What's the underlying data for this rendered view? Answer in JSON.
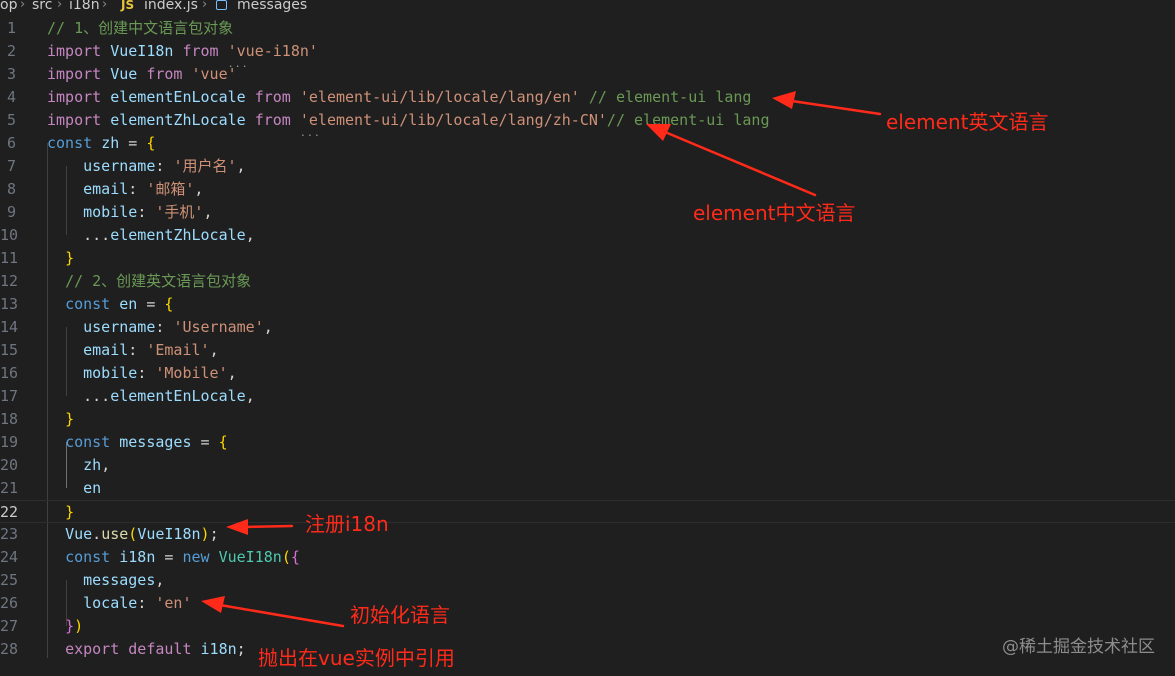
{
  "breadcrumb": {
    "root": "op",
    "folder1": "src",
    "folder2": "i18n",
    "file_badge": "JS",
    "file": "index.js",
    "symbol": "messages"
  },
  "gutter": {
    "numbers": [
      "1",
      "2",
      "3",
      "4",
      "5",
      "6",
      "7",
      "8",
      "9",
      "10",
      "11",
      "12",
      "13",
      "14",
      "15",
      "16",
      "17",
      "18",
      "19",
      "20",
      "21",
      "22",
      "23",
      "24",
      "25",
      "26",
      "27",
      "28"
    ],
    "active_line": "22"
  },
  "code": {
    "l1_comment": "// 1、创建中文语言包对象",
    "l2_import": "import",
    "l2_name": "VueI18n",
    "l2_from": "from",
    "l2_src": "'vue-i18n'",
    "l3_import": "import",
    "l3_name": "Vue",
    "l3_from": "from",
    "l3_src": "'vue'",
    "l4_import": "import",
    "l4_name": "elementEnLocale",
    "l4_from": "from",
    "l4_src": "'element-ui/lib/locale/lang/en'",
    "l4_comment": "// element-ui lang",
    "l5_import": "import",
    "l5_name": "elementZhLocale",
    "l5_from": "from",
    "l5_src": "'element-ui/lib/locale/lang/zh-CN'",
    "l5_comment": "// element-ui lang",
    "l6_const": "const",
    "l6_name": "zh",
    "l6_eq": " = ",
    "l6_brace": "{",
    "l7_key": "username",
    "l7_colon": ": ",
    "l7_val": "'用户名'",
    "l7_comma": ",",
    "l8_key": "email",
    "l8_colon": ": ",
    "l8_val": "'邮箱'",
    "l8_comma": ",",
    "l9_key": "mobile",
    "l9_colon": ": ",
    "l9_val": "'手机'",
    "l9_comma": ",",
    "l10_spread": "...",
    "l10_name": "elementZhLocale",
    "l10_comma": ",",
    "l11_brace": "}",
    "l12_comment": "// 2、创建英文语言包对象",
    "l13_const": "const",
    "l13_name": "en",
    "l13_eq": " = ",
    "l13_brace": "{",
    "l14_key": "username",
    "l14_colon": ": ",
    "l14_val": "'Username'",
    "l14_comma": ",",
    "l15_key": "email",
    "l15_colon": ": ",
    "l15_val": "'Email'",
    "l15_comma": ",",
    "l16_key": "mobile",
    "l16_colon": ": ",
    "l16_val": "'Mobile'",
    "l16_comma": ",",
    "l17_spread": "...",
    "l17_name": "elementEnLocale",
    "l17_comma": ",",
    "l18_brace": "}",
    "l19_const": "const",
    "l19_name": "messages",
    "l19_eq": " = ",
    "l19_brace": "{",
    "l20_name": "zh",
    "l20_comma": ",",
    "l21_name": "en",
    "l22_brace": "}",
    "l23_obj": "Vue",
    "l23_dot": ".",
    "l23_fn": "use",
    "l23_paren_open": "(",
    "l23_arg": "VueI18n",
    "l23_paren_close": ")",
    "l23_semi": ";",
    "l24_const": "const",
    "l24_name": "i18n",
    "l24_eq": " = ",
    "l24_new": "new",
    "l24_cls": "VueI18n",
    "l24_paren": "(",
    "l24_brace": "{",
    "l25_key": "messages",
    "l25_comma": ",",
    "l26_key": "locale",
    "l26_colon": ": ",
    "l26_val": "'en'",
    "l27_brace": "}",
    "l27_paren": ")",
    "l28_export": "export",
    "l28_default": "default",
    "l28_name": "i18n",
    "l28_semi": ";"
  },
  "annotations": {
    "en_lang": "element英文语言",
    "zh_lang": "element中文语言",
    "register": "注册i18n",
    "init_lang": "初始化语言",
    "export_note": "抛出在vue实例中引用"
  },
  "watermark": "@稀土掘金技术社区",
  "colors": {
    "background": "#1f1f1f",
    "keyword": "#569cd6",
    "control_keyword": "#c586c0",
    "variable": "#9cdcfe",
    "class": "#4ec9b0",
    "function": "#dcdcaa",
    "string": "#ce9178",
    "comment": "#6a9955",
    "annotation": "#ff2a1a"
  }
}
